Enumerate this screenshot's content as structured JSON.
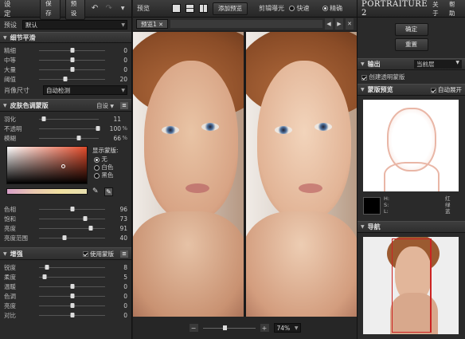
{
  "left": {
    "title": "设定",
    "save_label": "保存",
    "preset_label": "预设",
    "preset_field_label": "预设",
    "preset_value": "默认",
    "detail": {
      "title": "细节平滑",
      "rows": [
        {
          "label": "精细",
          "value": "0"
        },
        {
          "label": "中等",
          "value": "0"
        },
        {
          "label": "大量",
          "value": "0"
        },
        {
          "label": "阈值",
          "value": "20"
        }
      ],
      "pore_label": "肖像尺寸",
      "pore_value": "自动检测"
    },
    "skin": {
      "title": "皮肤色调蒙版",
      "mode": "自设",
      "rows": [
        {
          "label": "羽化",
          "value": "11",
          "unit": ""
        },
        {
          "label": "不透明",
          "value": "100",
          "unit": "%"
        },
        {
          "label": "模糊",
          "value": "66",
          "unit": "%"
        }
      ],
      "show_mask_label": "显示蒙版:",
      "radio": [
        "无",
        "白色",
        "黑色"
      ],
      "color_rows": [
        {
          "label": "色相",
          "value": "96"
        },
        {
          "label": "饱和",
          "value": "73"
        },
        {
          "label": "亮度",
          "value": "91"
        },
        {
          "label": "亮度范围",
          "value": "40"
        }
      ]
    },
    "enh": {
      "title": "增强",
      "use_mask_label": "使用蒙版",
      "rows": [
        {
          "label": "锐度",
          "value": "8"
        },
        {
          "label": "柔度",
          "value": "5"
        },
        {
          "label": "温暖",
          "value": "0"
        },
        {
          "label": "色调",
          "value": "0"
        },
        {
          "label": "亮度",
          "value": "0"
        },
        {
          "label": "对比",
          "value": "0"
        }
      ]
    }
  },
  "center": {
    "preview_label": "预览",
    "add_preview_label": "添加预览",
    "clip_label": "剪辑曝光",
    "fast_label": "快速",
    "accurate_label": "精确",
    "tab_label": "预览1",
    "zoom": "74%"
  },
  "right": {
    "logo": "PORTRAITURE 2",
    "about": "关于",
    "help": "帮助",
    "ok": "确定",
    "reset": "重置",
    "output_title": "输出",
    "output_value": "当前层",
    "create_mask_label": "创建透明蒙版",
    "mask_title": "蒙版预览",
    "auto_open": "自动展开",
    "hsl_labels": [
      "H:",
      "S:",
      "L:"
    ],
    "rgb_labels": [
      "红",
      "绿",
      "蓝"
    ],
    "nav_title": "导航"
  },
  "colors": {
    "accent_red": "#cc2222",
    "panel": "#2a2a2a"
  }
}
